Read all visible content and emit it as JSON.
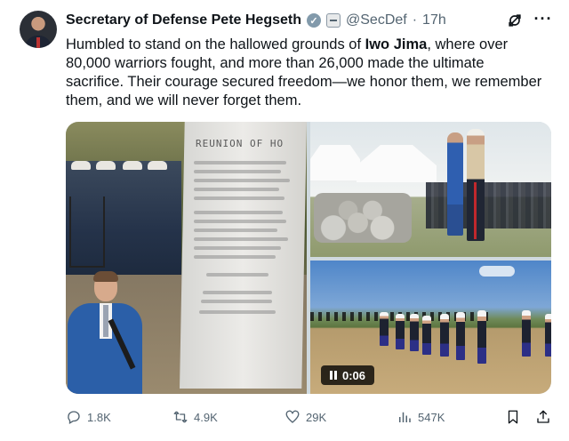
{
  "author": {
    "name": "Secretary of Defense Pete Hegseth",
    "handle": "@SecDef",
    "separator": "·",
    "time": "17h"
  },
  "tweet": {
    "text_before": "Humbled to stand on the hallowed grounds of ",
    "text_bold": "Iwo Jima",
    "text_after": ", where over 80,000 warriors fought, and more than 26,000 made the ultimate sacrifice. Their courage secured freedom—we honor them, we remember them, and we will never forget them."
  },
  "media": {
    "plaque_title": "REUNION OF HO",
    "video_duration": "0:06"
  },
  "actions": {
    "replies": "1.8K",
    "reposts": "4.9K",
    "likes": "29K",
    "views": "547K"
  },
  "icons": {
    "verified": "verified-badge-icon",
    "gov": "government-affiliate-icon",
    "grok": "grok-icon",
    "more": "more-options-icon"
  },
  "colors": {
    "text_primary": "#0f1419",
    "text_secondary": "#536471",
    "verified_badge": "#829aab"
  }
}
